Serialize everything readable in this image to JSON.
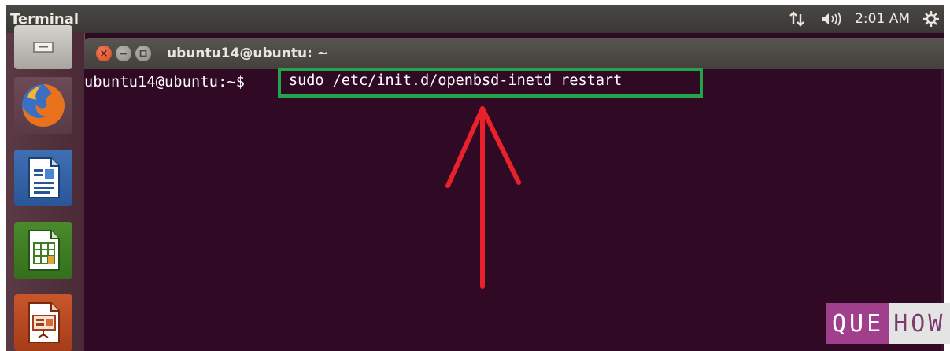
{
  "top_panel": {
    "app_title": "Terminal",
    "clock": "2:01 AM",
    "icons": [
      "network-icon",
      "sound-icon",
      "settings-gear-icon"
    ]
  },
  "launcher": {
    "items": [
      "files-icon",
      "firefox-icon",
      "libreoffice-writer-icon",
      "libreoffice-calc-icon",
      "libreoffice-impress-icon"
    ]
  },
  "terminal": {
    "window_title": "ubuntu14@ubuntu: ~",
    "prompt": "ubuntu14@ubuntu:~$",
    "command": "sudo /etc/init.d/openbsd-inetd restart"
  },
  "annotation": {
    "highlight_color": "#23a44a",
    "arrow_color": "#e8212b"
  },
  "watermark": {
    "part1": "QUE",
    "part2": "HOW"
  }
}
